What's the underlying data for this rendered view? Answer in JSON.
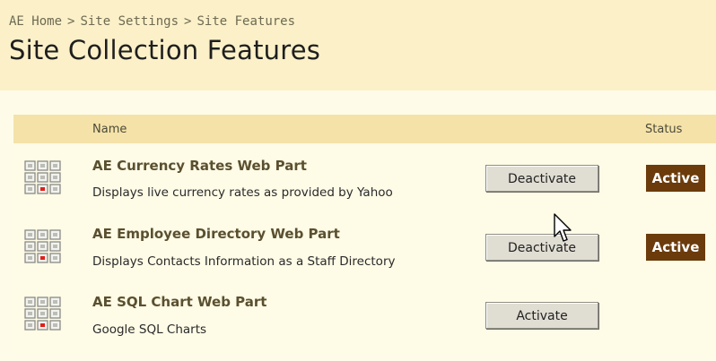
{
  "breadcrumb": {
    "items": [
      "AE Home",
      "Site Settings",
      "Site Features"
    ],
    "separator": ">"
  },
  "page_title": "Site Collection Features",
  "table": {
    "columns": {
      "name": "Name",
      "status": "Status"
    },
    "rows": [
      {
        "name": "AE Currency Rates Web Part",
        "description": "Displays live currency rates as provided by Yahoo",
        "button": "Deactivate",
        "status": "Active",
        "icon": "feature-grid-icon"
      },
      {
        "name": "AE Employee Directory Web Part",
        "description": "Displays Contacts Information as a Staff Directory",
        "button": "Deactivate",
        "status": "Active",
        "icon": "feature-grid-icon"
      },
      {
        "name": "AE SQL Chart Web Part",
        "description": "Google SQL Charts",
        "button": "Activate",
        "status": "",
        "icon": "feature-grid-icon"
      }
    ]
  },
  "colors": {
    "header_bg": "#fbf0c8",
    "table_header_bg": "#f5e2a8",
    "badge_bg": "#6b3b0b",
    "icon_accent": "#e0201a"
  },
  "cursor": "arrow-pointer-icon"
}
